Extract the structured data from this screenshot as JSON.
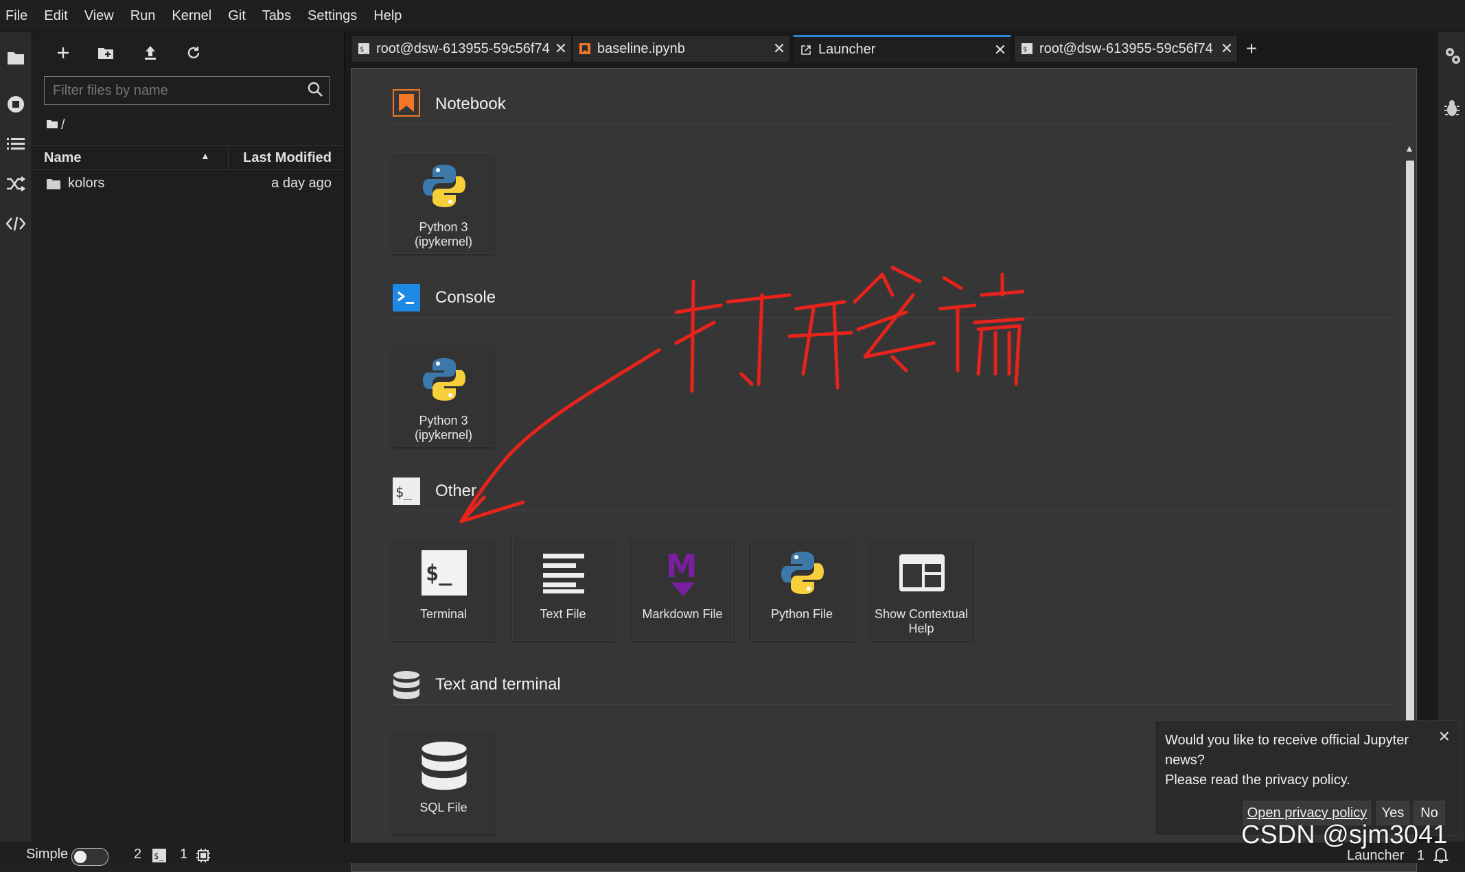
{
  "menu": [
    "File",
    "Edit",
    "View",
    "Run",
    "Kernel",
    "Git",
    "Tabs",
    "Settings",
    "Help"
  ],
  "filebrowser": {
    "filter_placeholder": "Filter files by name",
    "breadcrumb": "/",
    "col_name": "Name",
    "col_modified": "Last Modified",
    "files": [
      {
        "name": "kolors",
        "modified": "a day ago"
      }
    ]
  },
  "tabs": [
    {
      "label": "root@dsw-613955-59c56f74",
      "icon": "terminal-icon"
    },
    {
      "label": "baseline.ipynb",
      "icon": "notebook-icon"
    },
    {
      "label": "Launcher",
      "icon": "launcher-icon"
    },
    {
      "label": "root@dsw-613955-59c56f74",
      "icon": "terminal-icon"
    }
  ],
  "launcher": {
    "sections": {
      "notebook": {
        "title": "Notebook",
        "items": [
          "Python 3\n(ipykernel)"
        ]
      },
      "console": {
        "title": "Console",
        "items": [
          "Python 3\n(ipykernel)"
        ]
      },
      "other": {
        "title": "Other",
        "items": [
          "Terminal",
          "Text File",
          "Markdown File",
          "Python File",
          "Show Contextual Help"
        ]
      },
      "textterminal": {
        "title": "Text and terminal",
        "items": [
          "SQL File"
        ]
      }
    }
  },
  "annotation_text": "打开终端",
  "statusbar": {
    "mode": "Simple",
    "count1": "2",
    "count2": "1",
    "right_label": "Launcher",
    "right_count": "1"
  },
  "notification": {
    "line1": "Would you like to receive official Jupyter news?",
    "line2": "Please read the privacy policy.",
    "open_btn": "Open privacy policy",
    "yes_btn": "Yes",
    "no_btn": "No"
  },
  "watermark": "CSDN @sjm3041",
  "colors": {
    "accent": "#2f86d8",
    "annotation": "#e8231c",
    "notebook_orange": "#f37726",
    "markdown_purple": "#7b1fa2"
  }
}
